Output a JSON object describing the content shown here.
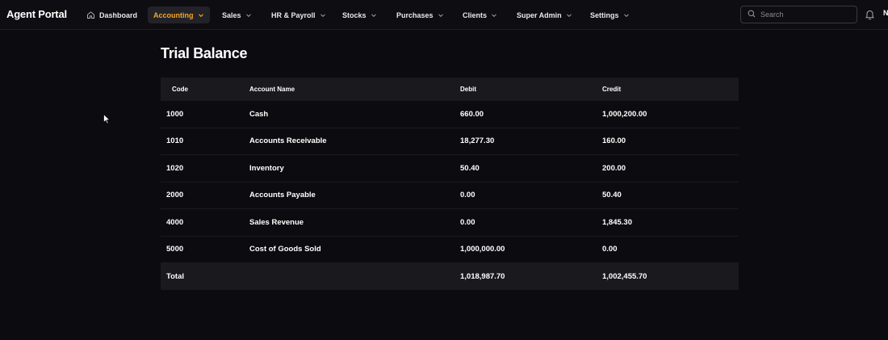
{
  "app": {
    "brand": "Agent Portal"
  },
  "nav": {
    "items": [
      {
        "label": "Dashboard",
        "icon": "home-icon",
        "active": false
      },
      {
        "label": "Accounting",
        "active": true
      },
      {
        "label": "Sales"
      },
      {
        "label": "HR & Payroll"
      },
      {
        "label": "Stocks"
      },
      {
        "label": "Purchases"
      },
      {
        "label": "Clients"
      },
      {
        "label": "Super Admin"
      },
      {
        "label": "Settings"
      }
    ],
    "active_color": "#f5a623"
  },
  "search": {
    "placeholder": "Search"
  },
  "user": {
    "initial": "N"
  },
  "page": {
    "title": "Trial Balance"
  },
  "table": {
    "headers": {
      "code": "Code",
      "account": "Account Name",
      "debit": "Debit",
      "credit": "Credit"
    },
    "rows": [
      {
        "code": "1000",
        "account": "Cash",
        "debit": "660.00",
        "credit": "1,000,200.00"
      },
      {
        "code": "1010",
        "account": "Accounts Receivable",
        "debit": "18,277.30",
        "credit": "160.00"
      },
      {
        "code": "1020",
        "account": "Inventory",
        "debit": "50.40",
        "credit": "200.00"
      },
      {
        "code": "2000",
        "account": "Accounts Payable",
        "debit": "0.00",
        "credit": "50.40"
      },
      {
        "code": "4000",
        "account": "Sales Revenue",
        "debit": "0.00",
        "credit": "1,845.30"
      },
      {
        "code": "5000",
        "account": "Cost of Goods Sold",
        "debit": "1,000,000.00",
        "credit": "0.00"
      }
    ],
    "total": {
      "label": "Total",
      "debit": "1,018,987.70",
      "credit": "1,002,455.70"
    }
  }
}
